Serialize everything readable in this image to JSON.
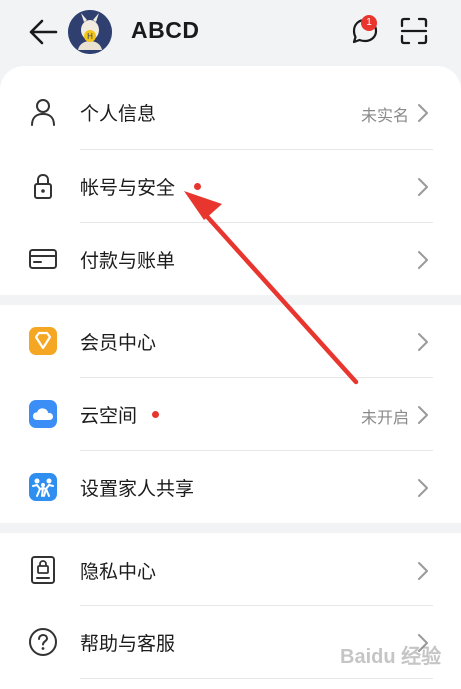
{
  "header": {
    "user_name": "ABCD",
    "message_badge": "1"
  },
  "sections": [
    {
      "items": [
        {
          "label": "个人信息",
          "value": "未实名",
          "icon": "person-icon",
          "dot": false
        },
        {
          "label": "帐号与安全",
          "value": "",
          "icon": "lock-icon",
          "dot": true
        },
        {
          "label": "付款与账单",
          "value": "",
          "icon": "card-icon",
          "dot": false
        }
      ]
    },
    {
      "items": [
        {
          "label": "会员中心",
          "value": "",
          "icon": "vip-diamond-icon",
          "dot": false
        },
        {
          "label": "云空间",
          "value": "未开启",
          "icon": "cloud-icon",
          "dot": true
        },
        {
          "label": "设置家人共享",
          "value": "",
          "icon": "family-share-icon",
          "dot": false
        }
      ]
    },
    {
      "items": [
        {
          "label": "隐私中心",
          "value": "",
          "icon": "privacy-icon",
          "dot": false
        },
        {
          "label": "帮助与客服",
          "value": "",
          "icon": "help-icon",
          "dot": false
        }
      ]
    }
  ],
  "colors": {
    "background": "#f1f3f5",
    "card": "#ffffff",
    "red_dot": "#e8362f",
    "annotation_arrow": "#e8362f",
    "vip_orange": "#f5a623",
    "cloud_blue": "#3a8ef6"
  },
  "watermark": "Baidu 经验"
}
